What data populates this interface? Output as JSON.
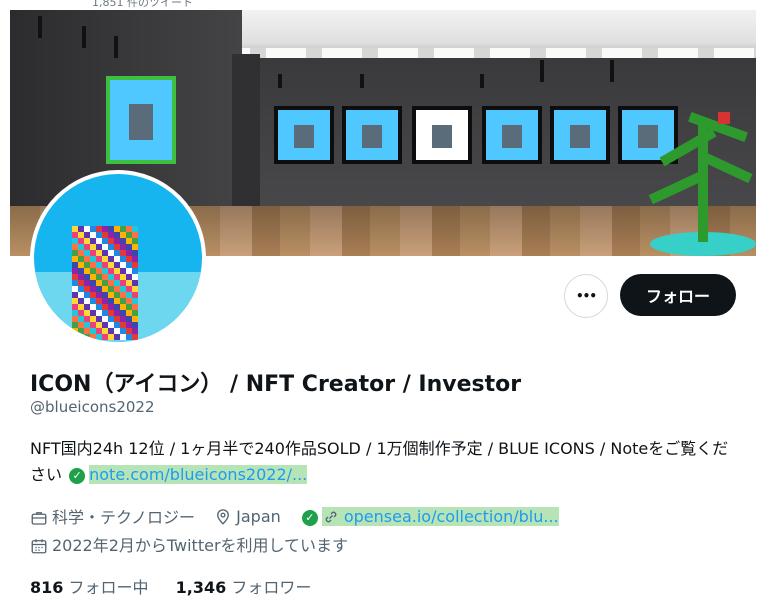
{
  "top_text": "1,851 件のツイート",
  "profile": {
    "name": "ICON（アイコン） / NFT Creator / Investor",
    "handle": "@blueicons2022",
    "bio_text": "NFT国内24h 12位 / 1ヶ月半で240作品SOLD / 1万個制作予定 / BLUE ICONS / Noteをご覧ください",
    "bio_link": "note.com/blueicons2022/...",
    "category": "科学・テクノロジー",
    "location": "Japan",
    "website": "opensea.io/collection/blu...",
    "joined": "2022年2月からTwitterを利用しています"
  },
  "buttons": {
    "more_label": "•••",
    "follow_label": "フォロー"
  },
  "counts": {
    "following_number": "816",
    "following_label": "フォロー中",
    "followers_number": "1,346",
    "followers_label": "フォロワー"
  },
  "colors": {
    "link": "#1d9bf0",
    "verified_check": "#1fa14a",
    "follow_button": "#0f1419",
    "avatar_background": "#16b5f0"
  },
  "icons": [
    "more-icon",
    "check-icon",
    "briefcase-icon",
    "location-icon",
    "link-icon",
    "calendar-icon"
  ]
}
